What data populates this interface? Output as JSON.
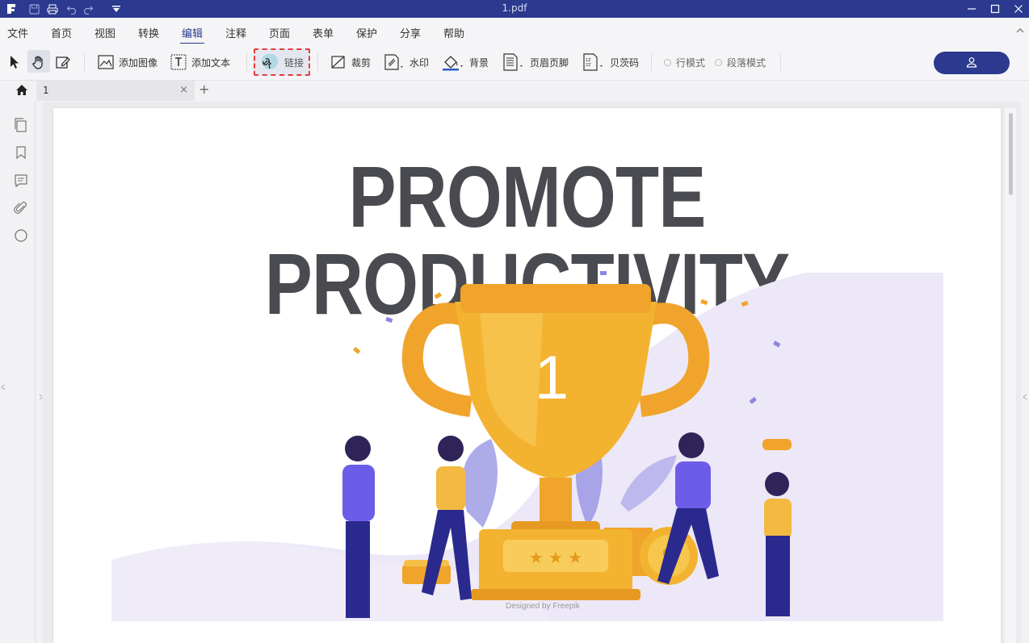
{
  "window": {
    "title": "1.pdf",
    "accent": "#2b3a8e"
  },
  "menu": {
    "items": [
      "文件",
      "首页",
      "视图",
      "转换",
      "编辑",
      "注释",
      "页面",
      "表单",
      "保护",
      "分享",
      "帮助"
    ],
    "active": "编辑"
  },
  "toolbar": {
    "add_image": "添加图像",
    "add_text": "添加文本",
    "link": "链接",
    "crop": "裁剪",
    "watermark": "水印",
    "background": "背景",
    "header_footer": "页眉页脚",
    "bates": "贝茨码",
    "line_mode": "行模式",
    "paragraph_mode": "段落模式"
  },
  "tabs": {
    "doc_name": "1",
    "close": "×",
    "add": "+"
  },
  "document": {
    "headline": "PROMOTE PRODUCTIVITY",
    "trophy_number": "1",
    "credit": "Designed by Freepik"
  },
  "icons": [
    "logo-icon",
    "save-icon",
    "print-icon",
    "undo-icon",
    "redo-icon",
    "quick-access-icon",
    "minimize-icon",
    "maximize-icon",
    "close-icon",
    "select-icon",
    "hand-icon",
    "edit-icon",
    "image-icon",
    "text-icon",
    "link-icon",
    "crop-icon",
    "watermark-icon",
    "background-icon",
    "header-footer-icon",
    "bates-icon",
    "user-icon",
    "home-icon",
    "pages-icon",
    "bookmark-icon",
    "comment-icon",
    "attachment-icon",
    "search-icon"
  ]
}
